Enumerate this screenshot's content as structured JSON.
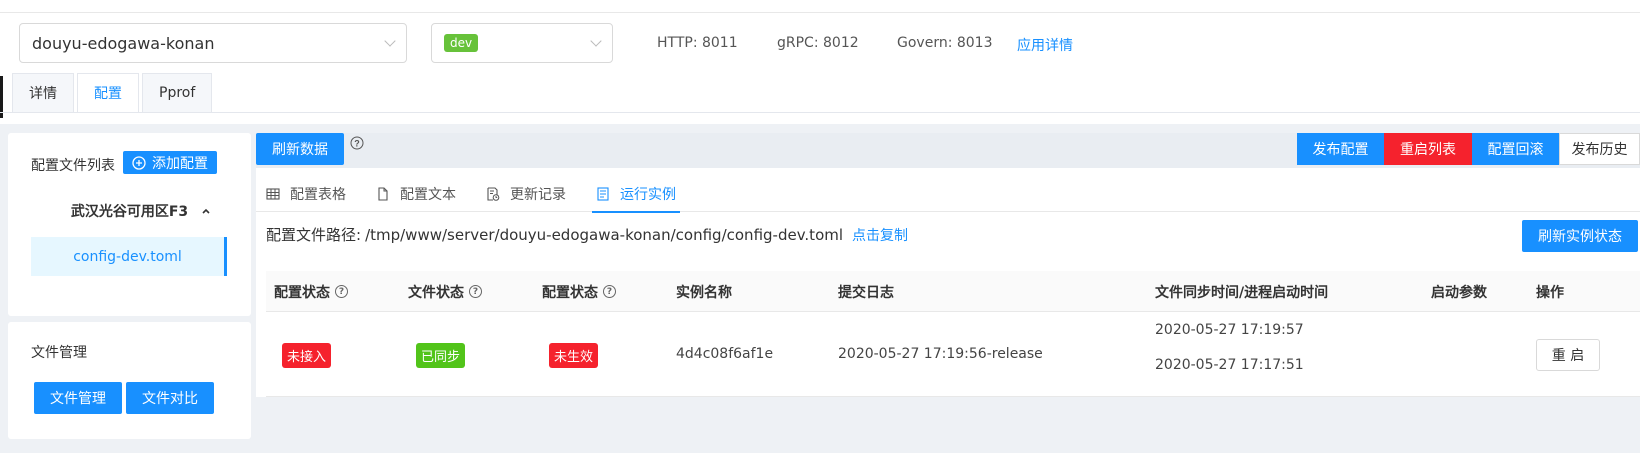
{
  "app_select": {
    "value": "douyu-edogawa-konan"
  },
  "env_select": {
    "value": "dev"
  },
  "ports": {
    "http": "HTTP: 8011",
    "grpc": "gRPC: 8012",
    "govern": "Govern: 8013"
  },
  "app_detail_link": "应用详情",
  "main_tabs": [
    {
      "label": "详情"
    },
    {
      "label": "配置"
    },
    {
      "label": "Pprof"
    }
  ],
  "sidebar": {
    "files_title": "配置文件列表",
    "add_config": "添加配置",
    "zone": "武汉光谷可用区F3",
    "file": "config-dev.toml",
    "mgmt_title": "文件管理",
    "file_mgmt_btn": "文件管理",
    "file_diff_btn": "文件对比"
  },
  "toolbar": {
    "refresh": "刷新数据",
    "publish": "发布配置",
    "restart_list": "重启列表",
    "rollback": "配置回滚",
    "history": "发布历史"
  },
  "sub_tabs": [
    {
      "label": "配置表格",
      "icon": "table-icon"
    },
    {
      "label": "配置文本",
      "icon": "file-icon"
    },
    {
      "label": "更新记录",
      "icon": "history-file-icon"
    },
    {
      "label": "运行实例",
      "icon": "instance-icon"
    }
  ],
  "path": {
    "label": "配置文件路径:",
    "value": "/tmp/www/server/douyu-edogawa-konan/config/config-dev.toml",
    "copy": "点击复制",
    "refresh_status": "刷新实例状态"
  },
  "table": {
    "headers": {
      "config_status": "配置状态",
      "file_status": "文件状态",
      "config_status2": "配置状态",
      "instance_name": "实例名称",
      "commit_log": "提交日志",
      "sync_time": "文件同步时间/进程启动时间",
      "start_args": "启动参数",
      "actions": "操作"
    },
    "row": {
      "config_status": "未接入",
      "file_status": "已同步",
      "config_status2": "未生效",
      "instance_name": "4d4c08f6af1e",
      "commit_log": "2020-05-27 17:19:56-release",
      "sync_time": "2020-05-27 17:19:57",
      "start_time": "2020-05-27 17:17:51",
      "start_args": "",
      "restart": "重 启"
    }
  },
  "colors": {
    "primary": "#1890ff",
    "danger": "#f5222d",
    "success": "#52c41a",
    "env_tag": "#67c23a"
  }
}
